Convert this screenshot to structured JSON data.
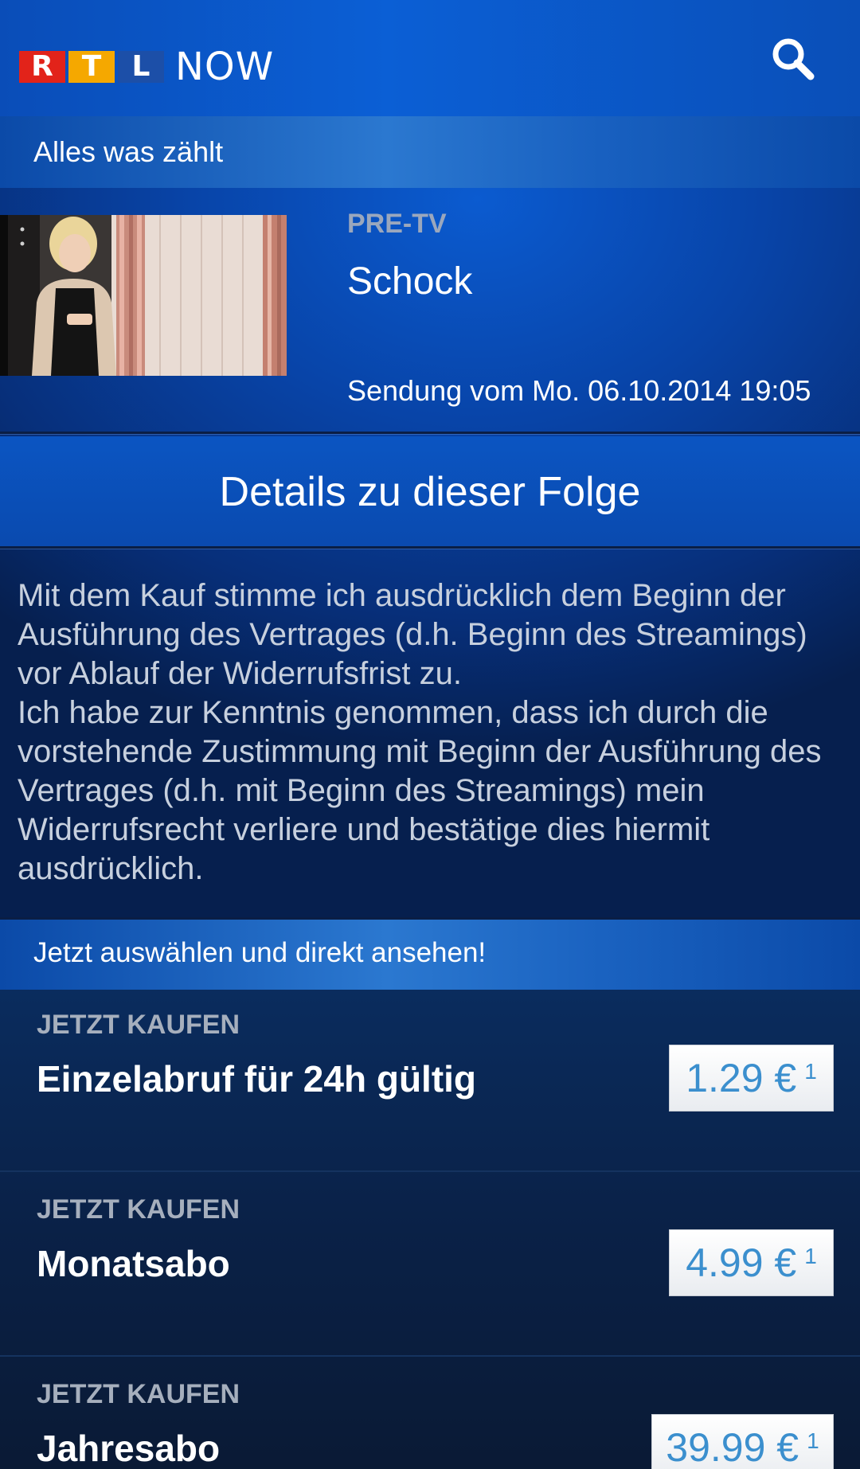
{
  "header": {
    "logo": {
      "letters": [
        "R",
        "T",
        "L"
      ],
      "suffix": "NOW"
    },
    "search_icon": "search-icon"
  },
  "show": {
    "title": "Alles was zählt"
  },
  "episode": {
    "category": "PRE-TV",
    "title": "Schock",
    "date": "Sendung vom Mo. 06.10.2014 19:05"
  },
  "details": {
    "heading": "Details zu dieser Folge",
    "paragraph1": "Mit dem Kauf stimme ich ausdrücklich dem Beginn der Ausführung des Vertrages (d.h. Beginn des Streamings) vor Ablauf der Widerrufsfrist zu.",
    "paragraph2": "Ich habe zur Kenntnis genommen, dass ich durch die vorstehende Zustimmung mit Beginn der Ausführung des Vertrages (d.h. mit Beginn des Streamings) mein Widerrufsrecht verliere und bestätige dies hiermit ausdrücklich."
  },
  "purchase": {
    "heading": "Jetzt auswählen und direkt ansehen!",
    "offers": [
      {
        "kicker": "JETZT KAUFEN",
        "name": "Einzelabruf für 24h gültig",
        "price": "1.29 €",
        "footnote": "1"
      },
      {
        "kicker": "JETZT KAUFEN",
        "name": "Monatsabo",
        "price": "4.99 €",
        "footnote": "1"
      },
      {
        "kicker": "JETZT KAUFEN",
        "name": "Jahresabo",
        "price": "39.99 €",
        "footnote": "1"
      }
    ]
  },
  "colors": {
    "header_blue": "#0b5fd5",
    "price_text": "#3b8fce",
    "rtl_red": "#e2231a",
    "rtl_yellow": "#f5a800",
    "rtl_blue": "#1c4fa8"
  }
}
